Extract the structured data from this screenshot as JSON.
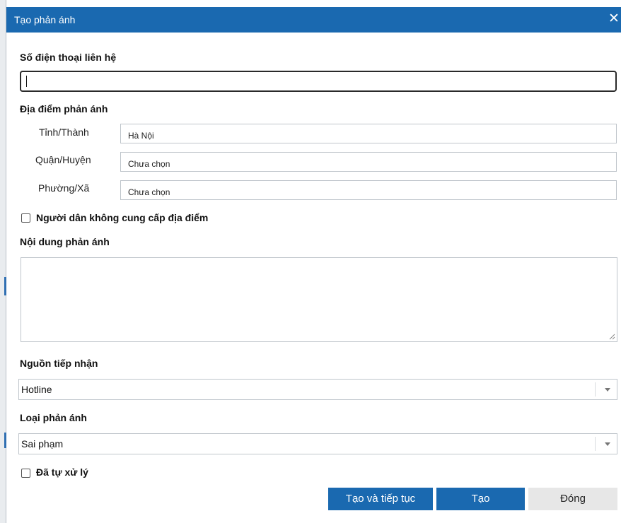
{
  "dialog": {
    "title": "Tạo phản ánh",
    "close_symbol": "✕"
  },
  "phone": {
    "label": "Số điện thoại liên hệ",
    "value": ""
  },
  "location": {
    "label": "Địa điểm phản ánh",
    "province": {
      "label": "Tỉnh/Thành",
      "value": "Hà Nội"
    },
    "district": {
      "label": "Quận/Huyện",
      "value": "Chưa chọn"
    },
    "ward": {
      "label": "Phường/Xã",
      "value": "Chưa chọn"
    }
  },
  "no_location": {
    "label": "Người dân không cung cấp địa điểm",
    "checked": false
  },
  "content": {
    "label": "Nội dung phản ánh",
    "value": ""
  },
  "source": {
    "label": "Nguồn tiếp nhận",
    "selected": "Hotline"
  },
  "category": {
    "label": "Loại phản ánh",
    "selected": "Sai phạm"
  },
  "self_handled": {
    "label": "Đã tự xử lý",
    "checked": false
  },
  "buttons": {
    "create_continue": "Tạo và tiếp tục",
    "create": "Tạo",
    "close": "Đóng"
  },
  "colors": {
    "primary": "#1a69b0",
    "secondary_button": "#e7e7e7",
    "border": "#bfc5cb"
  },
  "icons": {
    "close": "close-icon",
    "dropdown": "chevron-down-icon",
    "resize": "resize-grip-icon"
  }
}
